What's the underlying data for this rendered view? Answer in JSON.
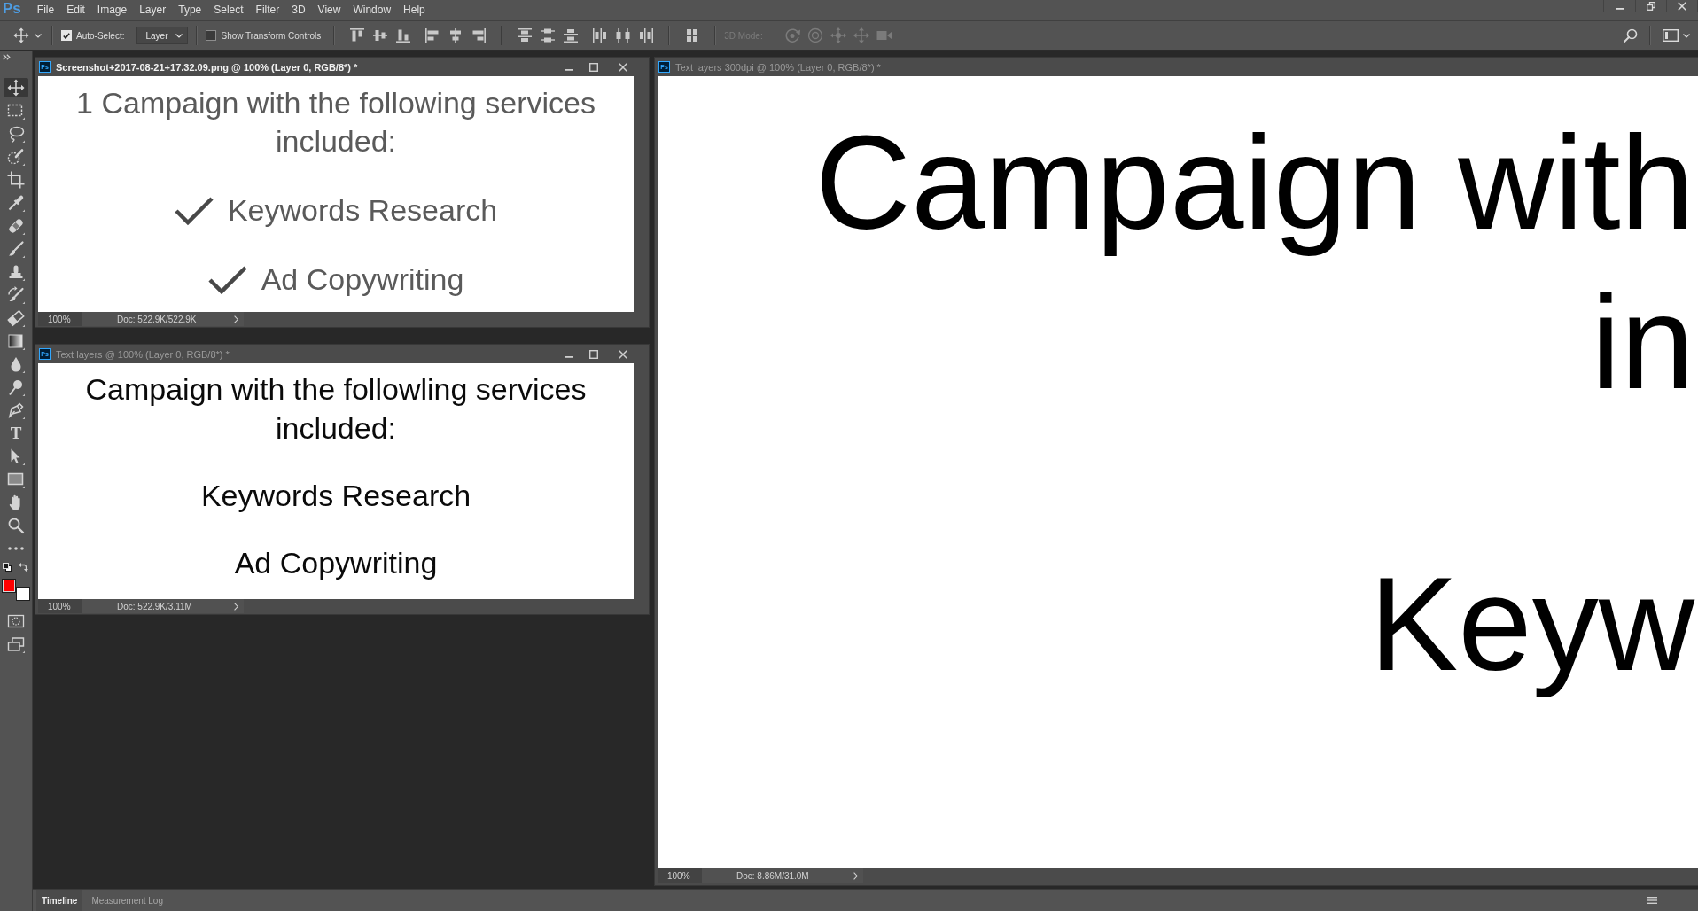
{
  "menu_bar": {
    "logo": "Ps",
    "items": [
      "File",
      "Edit",
      "Image",
      "Layer",
      "Type",
      "Select",
      "Filter",
      "3D",
      "View",
      "Window",
      "Help"
    ],
    "window_buttons": [
      {
        "kind": "minimize"
      },
      {
        "kind": "restore"
      },
      {
        "kind": "close"
      }
    ]
  },
  "options_bar": {
    "auto_select": {
      "label": "Auto-Select:",
      "checked": true
    },
    "target": {
      "value": "Layer"
    },
    "transform_controls": {
      "label": "Show Transform Controls",
      "checked": false
    },
    "align_sections": [
      [
        [
          {
            "kind": "align-top"
          },
          {
            "kind": "align-vcenter"
          },
          {
            "kind": "align-bottom"
          }
        ],
        [
          {
            "kind": "align-left"
          },
          {
            "kind": "align-hcenter"
          },
          {
            "kind": "align-right"
          }
        ]
      ],
      [
        [
          {
            "kind": "distribute-top"
          },
          {
            "kind": "distribute-vcenter"
          },
          {
            "kind": "distribute-bottom"
          }
        ],
        [
          {
            "kind": "distribute-left"
          },
          {
            "kind": "distribute-hcenter"
          },
          {
            "kind": "distribute-right"
          }
        ]
      ],
      [
        [
          {
            "kind": "auto-align"
          }
        ]
      ]
    ],
    "mode_3d": {
      "label": "3D Mode:",
      "disabled": true,
      "tools": [
        {
          "kind": "orbit"
        },
        {
          "kind": "roll"
        },
        {
          "kind": "pan"
        },
        {
          "kind": "slide"
        },
        {
          "kind": "camera"
        }
      ]
    }
  },
  "toolbar": {
    "tools": [
      {
        "kind": "move",
        "selected": true
      },
      {
        "kind": "marquee",
        "selected": false
      },
      {
        "kind": "lasso",
        "selected": false
      },
      {
        "kind": "quick-select",
        "selected": false
      },
      {
        "kind": "crop",
        "selected": false
      },
      {
        "kind": "eyedropper",
        "selected": false
      },
      {
        "kind": "healing",
        "selected": false
      },
      {
        "kind": "brush",
        "selected": false
      },
      {
        "kind": "stamp",
        "selected": false
      },
      {
        "kind": "history-brush",
        "selected": false
      },
      {
        "kind": "eraser",
        "selected": false
      },
      {
        "kind": "gradient",
        "selected": false
      },
      {
        "kind": "blur",
        "selected": false
      },
      {
        "kind": "dodge",
        "selected": false
      },
      {
        "kind": "pen",
        "selected": false
      },
      {
        "kind": "type",
        "glyph": "T",
        "selected": false
      },
      {
        "kind": "path-select",
        "selected": false
      },
      {
        "kind": "rectangle",
        "selected": false
      },
      {
        "kind": "hand",
        "selected": false
      },
      {
        "kind": "zoom",
        "selected": false
      },
      {
        "kind": "more",
        "selected": false
      }
    ],
    "swatches": [
      {
        "kind": "foreground",
        "color": "#ff0000"
      },
      {
        "kind": "background",
        "color": "#ffffff"
      }
    ],
    "mode_buttons": [
      {
        "kind": "quick-mask"
      },
      {
        "kind": "screen-mode"
      }
    ]
  },
  "documents": [
    {
      "badge": "Ps",
      "title": "Screenshot+2017-08-21+17.32.09.png @ 100% (Layer 0, RGB/8*) *",
      "active": true,
      "window_buttons": [
        {
          "kind": "minimize"
        },
        {
          "kind": "maximize"
        },
        {
          "kind": "close"
        }
      ],
      "canvas": {
        "kind": "checklist",
        "heading": "1 Campaign with the following services included:",
        "items": [
          {
            "text": "Keywords Research",
            "checked": true
          },
          {
            "text": "Ad Copywriting",
            "checked": true
          }
        ]
      },
      "zoom": "100%",
      "doc_info": "Doc: 522.9K/522.9K"
    },
    {
      "badge": "Ps",
      "title": "Text layers @ 100% (Layer 0, RGB/8*) *",
      "active": false,
      "window_buttons": [
        {
          "kind": "minimize"
        },
        {
          "kind": "maximize"
        },
        {
          "kind": "close"
        }
      ],
      "canvas": {
        "kind": "plain",
        "heading": "Campaign with the followling services included:",
        "lines": [
          "Keywords Research",
          "Ad Copywriting"
        ]
      },
      "zoom": "100%",
      "doc_info": "Doc: 522.9K/3.11M"
    },
    {
      "badge": "Ps",
      "title": "Text layers 300dpi @ 100% (Layer 0, RGB/8*) *",
      "active": false,
      "canvas": {
        "kind": "zoomed",
        "lines": [
          "Campaign with",
          "in",
          "Keyw"
        ]
      },
      "zoom": "100%",
      "doc_info": "Doc: 8.86M/31.0M"
    }
  ],
  "panel_tabs": [
    {
      "label": "Timeline",
      "selected": true
    },
    {
      "label": "Measurement Log",
      "selected": false
    }
  ]
}
